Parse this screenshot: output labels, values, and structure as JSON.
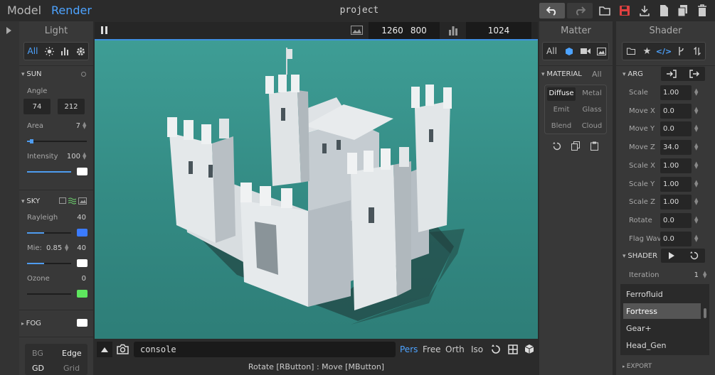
{
  "topbar": {
    "tab_model": "Model",
    "tab_render": "Render",
    "project": "project",
    "accent": "#4da3ff",
    "save_color": "#e04040"
  },
  "light": {
    "title": "Light",
    "filter_all": "All",
    "sun": {
      "heading": "SUN",
      "angle_label": "Angle",
      "angle_1": "74",
      "angle_2": "212",
      "area_label": "Area",
      "area_value": "7",
      "area_level": 0.05,
      "intensity_label": "Intensity",
      "intensity_value": "100",
      "intensity_level": 1.0
    },
    "sky": {
      "heading": "SKY",
      "rayleigh_label": "Rayleigh",
      "rayleigh_value": "40",
      "rayleigh_color": "#3b7bff",
      "mie_label": "Mie:",
      "mie_factor": "0.85",
      "mie_value": "40",
      "mie_color": "#ffffff",
      "ozone_label": "Ozone",
      "ozone_value": "0",
      "ozone_color": "#5ee65e"
    },
    "fog": {
      "heading": "FOG",
      "color": "#ffffff"
    },
    "bg_toggle": {
      "bg": "BG",
      "edge": "Edge",
      "gd": "GD",
      "grid": "Grid"
    }
  },
  "render": {
    "width": "1260",
    "height": "800",
    "samples": "1024",
    "console_text": "console",
    "view_modes": [
      "Pers",
      "Free",
      "Orth",
      "Iso"
    ],
    "status": "Rotate [RButton] : Move [MButton]",
    "viewport_bg": "#3a9790"
  },
  "matter": {
    "title": "Matter",
    "filter_all": "All",
    "heading": "MATERIAL",
    "heading_all": "All",
    "types": [
      "Diffuse",
      "Metal",
      "Emit",
      "Glass",
      "Blend",
      "Cloud"
    ]
  },
  "shader": {
    "title": "Shader",
    "arg_heading": "ARG",
    "args": [
      {
        "label": "Scale",
        "value": "1.00"
      },
      {
        "label": "Move X",
        "value": "0.0"
      },
      {
        "label": "Move Y",
        "value": "0.0"
      },
      {
        "label": "Move Z",
        "value": "34.0"
      },
      {
        "label": "Scale X",
        "value": "1.00"
      },
      {
        "label": "Scale Y",
        "value": "1.00"
      },
      {
        "label": "Scale Z",
        "value": "1.00"
      },
      {
        "label": "Rotate",
        "value": "0.0"
      },
      {
        "label": "Flag Wavi",
        "value": "0.0"
      }
    ],
    "shader_heading": "SHADER",
    "iteration_label": "Iteration",
    "iteration_value": "1",
    "list": [
      "Ferrofluid",
      "Fortress",
      "Gear+",
      "Head_Gen"
    ],
    "selected": "Fortress",
    "export_heading": "EXPORT"
  }
}
